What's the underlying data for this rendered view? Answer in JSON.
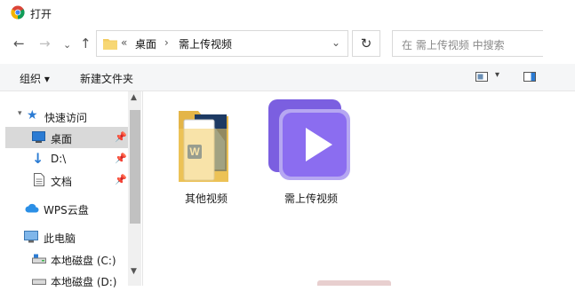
{
  "window": {
    "title": "打开"
  },
  "address": {
    "prefix": "«",
    "segments": [
      "桌面",
      "需上传视频"
    ],
    "separator": "›"
  },
  "search": {
    "placeholder": "在 需上传视频 中搜索"
  },
  "toolbar": {
    "organize": "组织 ▾",
    "new_folder": "新建文件夹"
  },
  "sidebar": {
    "items": [
      {
        "label": "快速访问",
        "icon": "star-icon"
      },
      {
        "label": "桌面",
        "icon": "desktop-icon",
        "selected": true,
        "pinned": true
      },
      {
        "label": "D:\\",
        "icon": "download-icon",
        "pinned": true
      },
      {
        "label": "文档",
        "icon": "document-icon",
        "pinned": true
      },
      {
        "label": "WPS云盘",
        "icon": "cloud-icon"
      },
      {
        "label": "此电脑",
        "icon": "computer-icon"
      },
      {
        "label": "本地磁盘 (C:)",
        "icon": "drive-icon"
      },
      {
        "label": "本地磁盘 (D:)",
        "icon": "drive-icon"
      }
    ]
  },
  "files": [
    {
      "name": "其他视频",
      "type": "folder"
    },
    {
      "name": "需上传视频",
      "type": "video-app"
    }
  ],
  "colors": {
    "folder": "#f3cc62",
    "video_purple": "#8b6df0",
    "selection": "#d9d9d9",
    "accent": "#2b7bd3"
  }
}
